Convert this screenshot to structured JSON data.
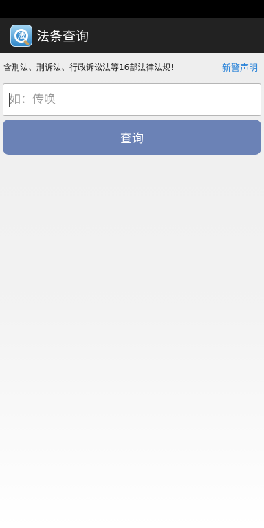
{
  "app_bar": {
    "title": "法条查询",
    "icon_glyph": "法",
    "background": "#222222"
  },
  "notice": {
    "text": "含刑法、刑诉法、行政诉讼法等16部法律法规!",
    "disclaimer_link": "新警声明",
    "link_color": "#2a83d8"
  },
  "search": {
    "value": "",
    "placeholder": "如：传唤"
  },
  "query_button": {
    "label": "查询",
    "color": "#6b82b6"
  }
}
